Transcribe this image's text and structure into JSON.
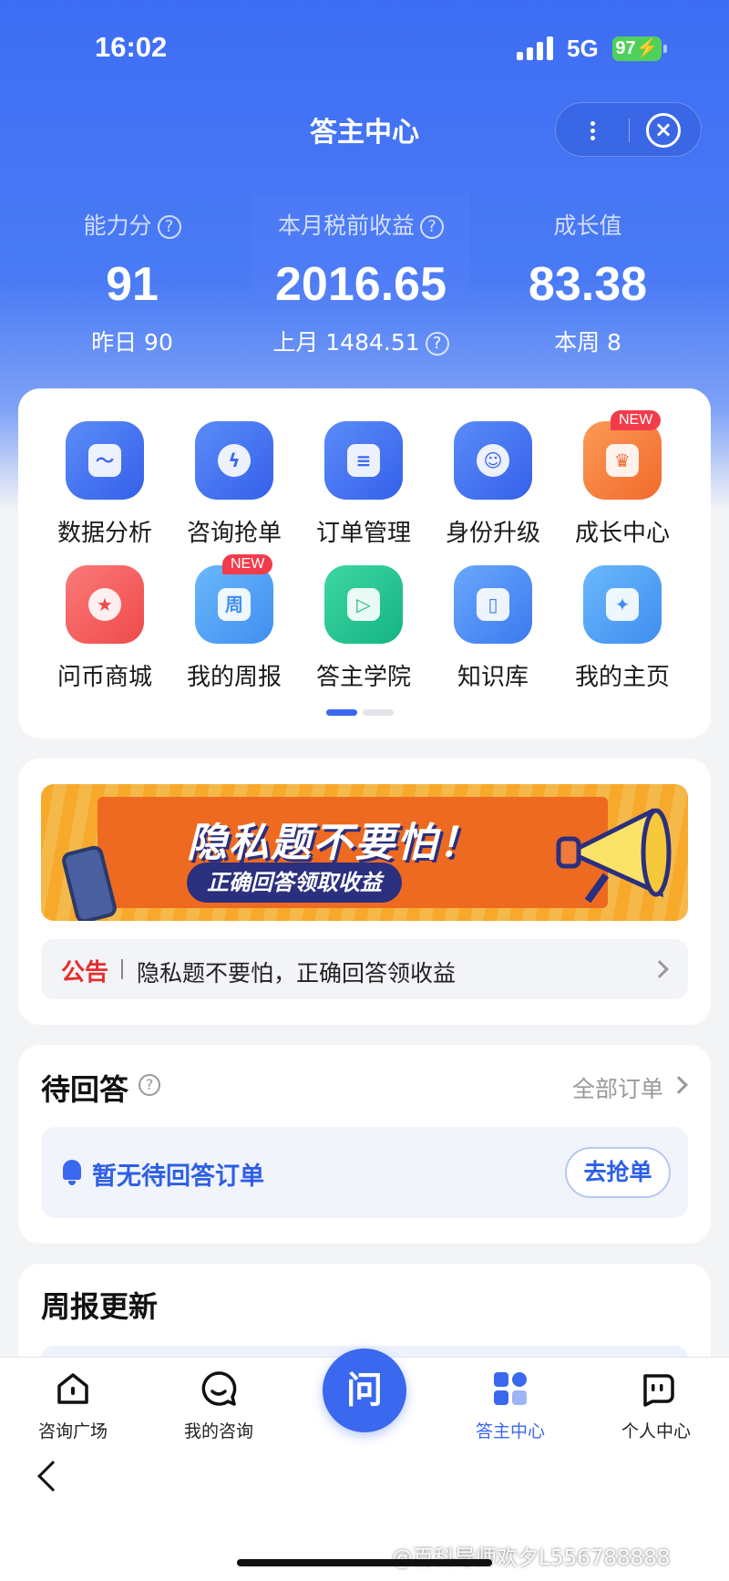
{
  "status_bar": {
    "time": "16:02",
    "network": "5G",
    "battery": "97"
  },
  "header": {
    "title": "答主中心"
  },
  "stats": {
    "ability": {
      "label": "能力分",
      "value": "91",
      "sub": "昨日 90"
    },
    "income": {
      "label": "本月税前收益",
      "value": "2016.65",
      "sub": "上月 1484.51"
    },
    "growth": {
      "label": "成长值",
      "value": "83.38",
      "sub": "本周 8"
    }
  },
  "grid": {
    "items": [
      {
        "label": "数据分析",
        "icon": "chart-icon",
        "color": "#3f6ff0"
      },
      {
        "label": "咨询抢单",
        "icon": "lightning-icon",
        "color": "#3f6ff0"
      },
      {
        "label": "订单管理",
        "icon": "document-icon",
        "color": "#3f6ff0"
      },
      {
        "label": "身份升级",
        "icon": "user-icon",
        "color": "#3f6ff0"
      },
      {
        "label": "成长中心",
        "icon": "crown-icon",
        "color": "#f5733b",
        "badge": "NEW"
      },
      {
        "label": "问币商城",
        "icon": "shop-icon",
        "color": "#f25a5a"
      },
      {
        "label": "我的周报",
        "icon": "calendar-icon",
        "color": "#4aa0f2",
        "badge": "NEW",
        "glyph": "周"
      },
      {
        "label": "答主学院",
        "icon": "play-icon",
        "color": "#1fbf8f"
      },
      {
        "label": "知识库",
        "icon": "book-icon",
        "color": "#4a8af2"
      },
      {
        "label": "我的主页",
        "icon": "star-icon",
        "color": "#4aa0f2"
      }
    ]
  },
  "banner": {
    "title": "隐私题不要怕！",
    "subtitle": "正确回答领取收益"
  },
  "notice": {
    "tag": "公告",
    "text": "隐私题不要怕，正确回答领收益"
  },
  "pending": {
    "title": "待回答",
    "all_orders": "全部订单",
    "empty_text": "暂无待回答订单",
    "grab_button": "去抢单"
  },
  "weekly": {
    "title": "周报更新"
  },
  "tabbar": {
    "tabs": [
      {
        "label": "咨询广场",
        "icon": "home-icon"
      },
      {
        "label": "我的咨询",
        "icon": "chat-icon"
      },
      {
        "label": "答主中心",
        "icon": "apps-icon",
        "active": true
      },
      {
        "label": "个人中心",
        "icon": "profile-icon"
      }
    ],
    "fab_label": "问"
  },
  "watermark": "@百科导师欢夕L556788888",
  "colors": {
    "primary": "#3a68ee",
    "alert": "#e62e2e",
    "badge": "#f23b4b"
  }
}
